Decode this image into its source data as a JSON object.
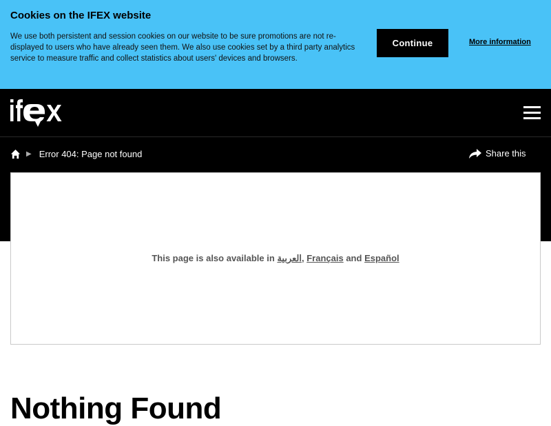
{
  "cookie_banner": {
    "title": "Cookies on the IFEX website",
    "text": "We use both persistent and session cookies on our website to be sure promotions are not re-displayed to users who have already seen them. We also use cookies set by a third party analytics service to measure traffic and collect statistics about users' devices and browsers.",
    "continue_label": "Continue",
    "more_info_label": "More information",
    "background_color": "#49c2f7"
  },
  "header": {
    "logo_text": "ifex",
    "menu_icon": "hamburger-menu-icon",
    "background_color": "#000000"
  },
  "breadcrumb": {
    "home_icon": "home-icon",
    "separator": "▶",
    "current": "Error 404: Page not found"
  },
  "share": {
    "icon": "share-arrow-icon",
    "label": "Share this"
  },
  "languages": {
    "prefix": "This page is also available in",
    "arabic": "العربية",
    "comma": ",",
    "french": "Français",
    "and": "and",
    "spanish": "Español"
  },
  "main": {
    "heading": "Nothing Found"
  }
}
